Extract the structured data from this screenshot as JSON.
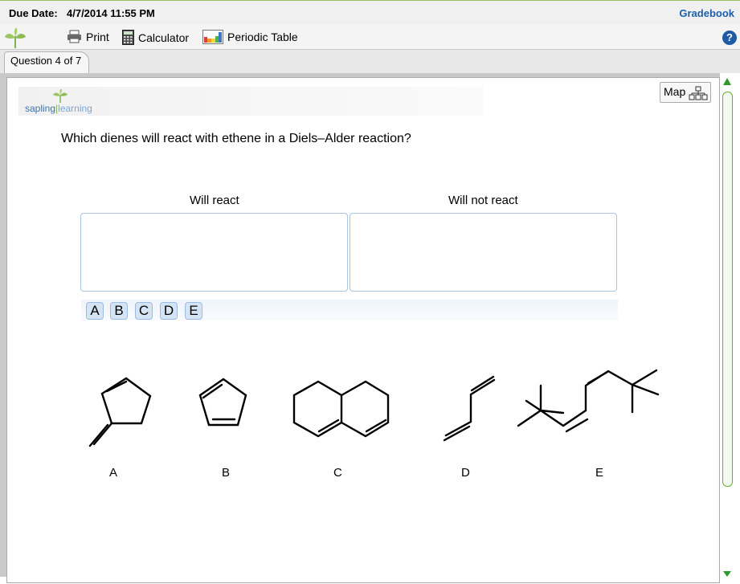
{
  "header": {
    "due_label": "Due Date:",
    "due_value": "4/7/2014 11:55 PM",
    "gradebook": "Gradebook"
  },
  "toolbar": {
    "print": "Print",
    "calculator": "Calculator",
    "periodic_table": "Periodic Table",
    "help_icon": "question-mark-icon"
  },
  "tabs": [
    {
      "label": "Question 4 of 7"
    }
  ],
  "logo": {
    "part1": "sapling",
    "part2": "learning"
  },
  "map_button": {
    "label": "Map"
  },
  "question": {
    "text": "Which dienes will react with ethene in a Diels–Alder reaction?"
  },
  "categories": {
    "react": "Will react",
    "not_react": "Will not react"
  },
  "tokens": [
    "A",
    "B",
    "C",
    "D",
    "E"
  ],
  "molecule_labels": [
    "A",
    "B",
    "C",
    "D",
    "E"
  ],
  "colors": {
    "link": "#1c5fa8",
    "accent_green": "#2e9a2e",
    "token_bg": "#d5e4f4"
  }
}
